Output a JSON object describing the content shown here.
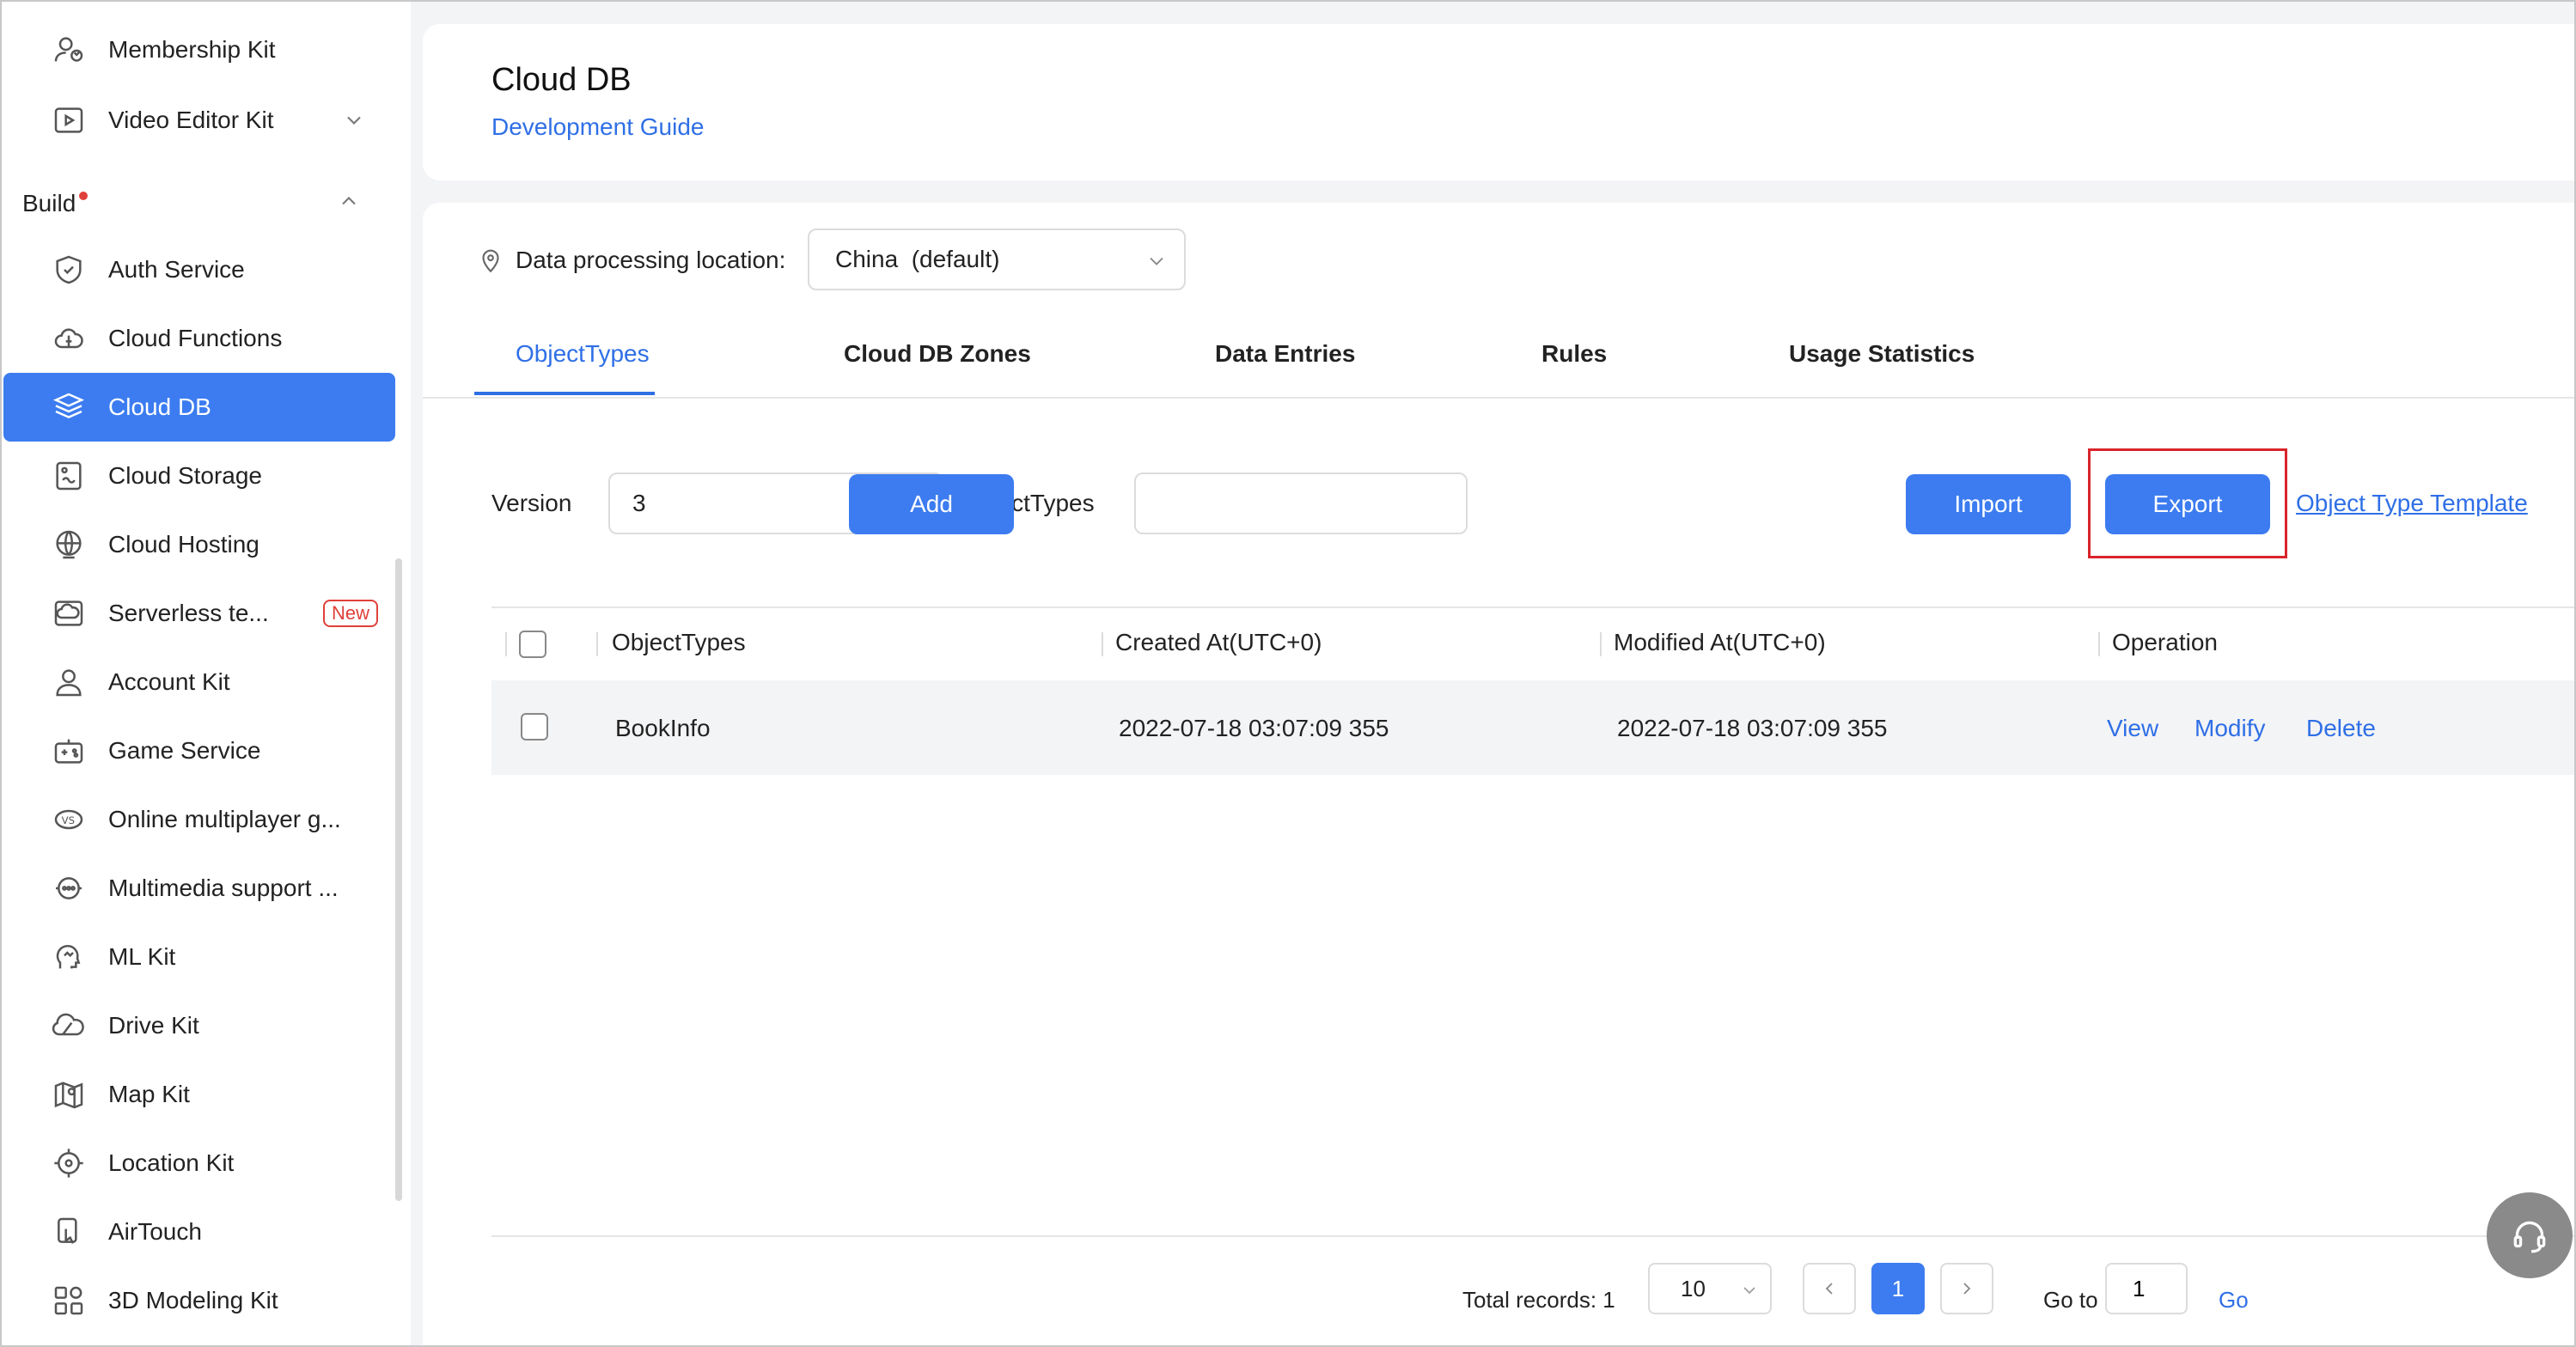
{
  "sidebar": {
    "items_top": [
      {
        "label": "Membership Kit",
        "icon": "membership-icon"
      },
      {
        "label": "Video Editor Kit",
        "icon": "video-editor-icon"
      }
    ],
    "build_label": "Build",
    "items": [
      {
        "label": "Auth Service",
        "icon": "shield-icon"
      },
      {
        "label": "Cloud Functions",
        "icon": "cloud-functions-icon"
      },
      {
        "label": "Cloud DB",
        "icon": "database-icon"
      },
      {
        "label": "Cloud Storage",
        "icon": "storage-icon"
      },
      {
        "label": "Cloud Hosting",
        "icon": "globe-icon"
      },
      {
        "label": "Serverless te...",
        "icon": "serverless-icon",
        "badge": "New"
      },
      {
        "label": "Account Kit",
        "icon": "user-icon"
      },
      {
        "label": "Game Service",
        "icon": "gamepad-icon"
      },
      {
        "label": "Online multiplayer g...",
        "icon": "versus-icon"
      },
      {
        "label": "Multimedia support ...",
        "icon": "multimedia-icon"
      },
      {
        "label": "ML Kit",
        "icon": "ml-icon"
      },
      {
        "label": "Drive Kit",
        "icon": "drive-icon"
      },
      {
        "label": "Map Kit",
        "icon": "map-icon"
      },
      {
        "label": "Location Kit",
        "icon": "location-target-icon"
      },
      {
        "label": "AirTouch",
        "icon": "airtouch-icon"
      },
      {
        "label": "3D Modeling Kit",
        "icon": "modeling-icon"
      }
    ],
    "active": "Cloud DB"
  },
  "header": {
    "title": "Cloud DB",
    "guide_link": "Development Guide"
  },
  "location": {
    "label": "Data processing location:",
    "value": "China  (default)"
  },
  "tabs": [
    {
      "label": "ObjectTypes",
      "active": true
    },
    {
      "label": "Cloud DB Zones"
    },
    {
      "label": "Data Entries"
    },
    {
      "label": "Rules"
    },
    {
      "label": "Usage Statistics"
    }
  ],
  "filters": {
    "version_label": "Version",
    "version_value": "3",
    "objtypes_label": "ObjectTypes",
    "objtypes_value": ""
  },
  "actions": {
    "add": "Add",
    "import": "Import",
    "export": "Export",
    "template_link": "Object Type Template"
  },
  "table": {
    "columns": [
      "ObjectTypes",
      "Created At(UTC+0)",
      "Modified At(UTC+0)",
      "Operation"
    ],
    "rows": [
      {
        "name": "BookInfo",
        "created": "2022-07-18 03:07:09 355",
        "modified": "2022-07-18 03:07:09 355",
        "ops": [
          "View",
          "Modify",
          "Delete"
        ]
      }
    ]
  },
  "pagination": {
    "total_label": "Total records: 1",
    "page_size": "10",
    "current_page": "1",
    "goto_label": "Go to",
    "goto_value": "1",
    "go_label": "Go"
  },
  "colors": {
    "accent": "#3c7cf0",
    "link": "#2f6fe6",
    "highlight": "#d9242b",
    "badge": "#e0403a"
  }
}
